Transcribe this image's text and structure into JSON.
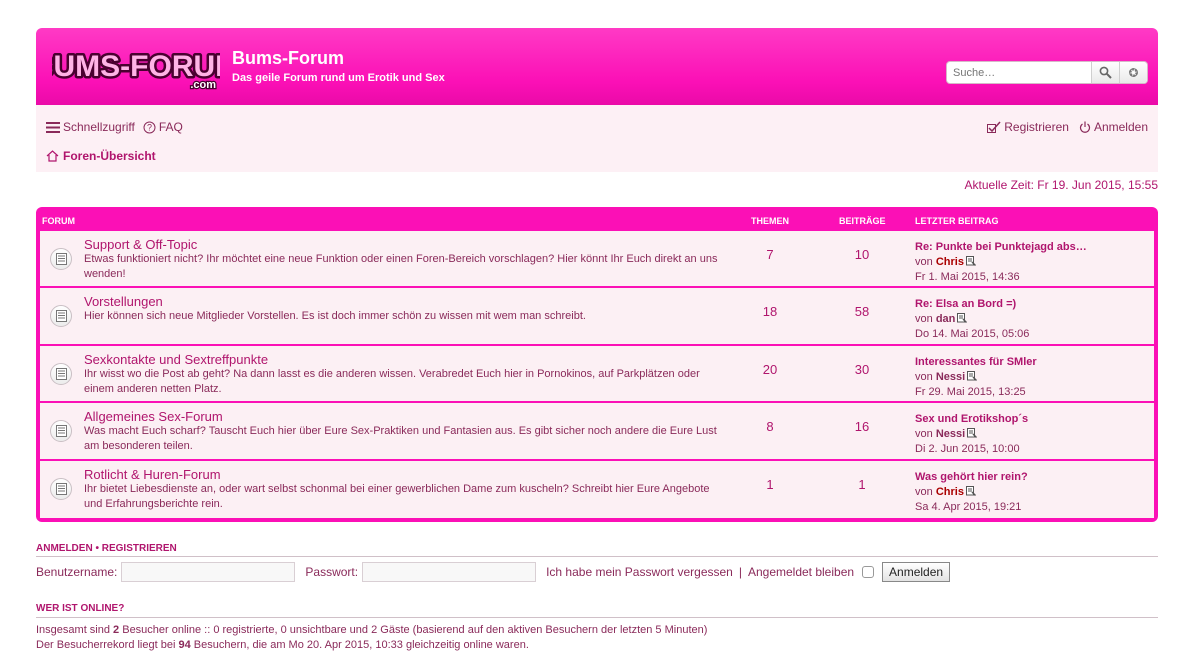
{
  "header": {
    "logo_text": "BUMS-FORUM",
    "logo_sub": ".com",
    "title": "Bums-Forum",
    "description": "Das geile Forum rund um Erotik und Sex",
    "search_placeholder": "Suche…"
  },
  "nav": {
    "quicklinks": "Schnellzugriff",
    "faq": "FAQ",
    "register": "Registrieren",
    "login": "Anmelden",
    "breadcrumb": "Foren-Übersicht"
  },
  "current_time": "Aktuelle Zeit: Fr 19. Jun 2015, 15:55",
  "table": {
    "col_forum": "Forum",
    "col_topics": "Themen",
    "col_posts": "Beiträge",
    "col_last": "Letzter Beitrag",
    "rows": [
      {
        "title": "Support & Off-Topic",
        "desc": "Etwas funktioniert nicht? Ihr möchtet eine neue Funktion oder einen Foren-Bereich vorschlagen? Hier könnt Ihr Euch direkt an uns wenden!",
        "topics": "7",
        "posts": "10",
        "last_title": "Re: Punkte bei Punktejagd abs…",
        "by": "von",
        "author": "Chris",
        "author_color": "#aa0000",
        "date": "Fr 1. Mai 2015, 14:36"
      },
      {
        "title": "Vorstellungen",
        "desc": "Hier können sich neue Mitglieder Vorstellen. Es ist doch immer schön zu wissen mit wem man schreibt.",
        "topics": "18",
        "posts": "58",
        "last_title": "Re: Elsa an Bord =)",
        "by": "von",
        "author": "dan",
        "author_color": "#8a2a5a",
        "date": "Do 14. Mai 2015, 05:06"
      },
      {
        "title": "Sexkontakte und Sextreffpunkte",
        "desc": "Ihr wisst wo die Post ab geht? Na dann lasst es die anderen wissen. Verabredet Euch hier in Pornokinos, auf Parkplätzen oder einem anderen netten Platz.",
        "topics": "20",
        "posts": "30",
        "last_title": "Interessantes für SMler",
        "by": "von",
        "author": "Nessi",
        "author_color": "#8a2a5a",
        "date": "Fr 29. Mai 2015, 13:25"
      },
      {
        "title": "Allgemeines Sex-Forum",
        "desc": "Was macht Euch scharf? Tauscht Euch hier über Eure Sex-Praktiken und Fantasien aus. Es gibt sicher noch andere die Eure Lust am besonderen teilen.",
        "topics": "8",
        "posts": "16",
        "last_title": "Sex und Erotikshop´s",
        "by": "von",
        "author": "Nessi",
        "author_color": "#8a2a5a",
        "date": "Di 2. Jun 2015, 10:00"
      },
      {
        "title": "Rotlicht & Huren-Forum",
        "desc": "Ihr bietet Liebesdienste an, oder wart selbst schonmal bei einer gewerblichen Dame zum kuscheln? Schreibt hier Eure Angebote und Erfahrungsberichte rein.",
        "topics": "1",
        "posts": "1",
        "last_title": "Was gehört hier rein?",
        "by": "von",
        "author": "Chris",
        "author_color": "#aa0000",
        "date": "Sa 4. Apr 2015, 19:21"
      }
    ]
  },
  "login_section": {
    "heading_login": "Anmelden",
    "heading_dot": "•",
    "heading_register": "Registrieren",
    "username_label": "Benutzername:",
    "password_label": "Passwort:",
    "forgot": "Ich habe mein Passwort vergessen",
    "separator": "|",
    "remember": "Angemeldet bleiben",
    "submit": "Anmelden"
  },
  "online": {
    "heading": "Wer ist online?",
    "line1_a": "Insgesamt sind ",
    "line1_count": "2",
    "line1_b": " Besucher online :: 0 registrierte, 0 unsichtbare und 2 Gäste (basierend auf den aktiven Besuchern der letzten 5 Minuten)",
    "line2_a": "Der Besucherrekord liegt bei ",
    "line2_count": "94",
    "line2_b": " Besuchern, die am Mo 20. Apr 2015, 10:33 gleichzeitig online waren."
  },
  "colors": {
    "brand": "#fb10b6",
    "text": "#8a2a5a",
    "link": "#b0156d",
    "row_bg": "#fcf0f4"
  }
}
